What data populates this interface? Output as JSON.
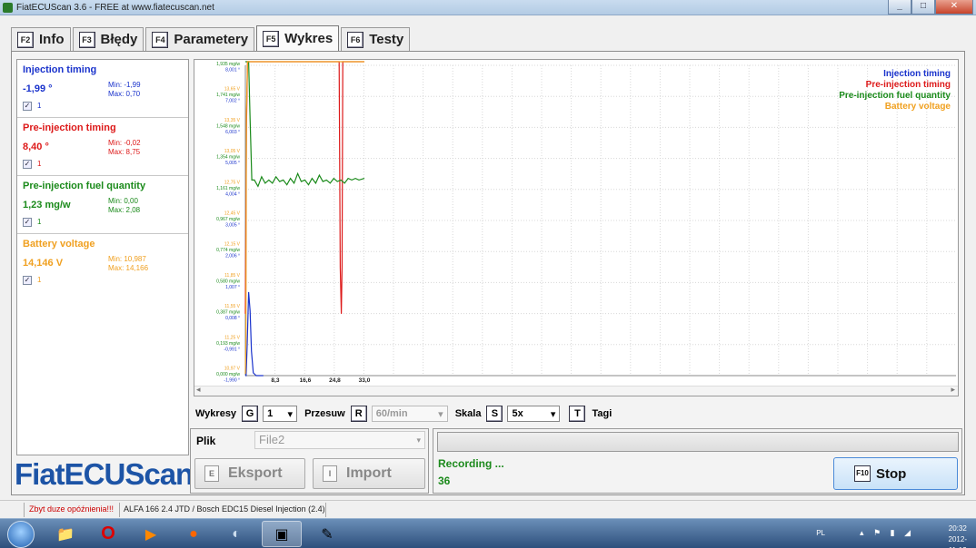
{
  "window": {
    "title": "FiatECUScan 3.6 - FREE at www.fiatecuscan.net"
  },
  "tabs": [
    {
      "key": "F2",
      "label": "Info"
    },
    {
      "key": "F3",
      "label": "Błędy"
    },
    {
      "key": "F4",
      "label": "Parametery"
    },
    {
      "key": "F5",
      "label": "Wykres"
    },
    {
      "key": "F6",
      "label": "Testy"
    }
  ],
  "params": [
    {
      "name": "Injection timing",
      "value": "-1,99 °",
      "min": "Min: -1,99",
      "max": "Max: 0,70",
      "checkbox_label": "1",
      "color": "#1a33cc"
    },
    {
      "name": "Pre-injection timing",
      "value": "8,40 °",
      "min": "Min: -0,02",
      "max": "Max: 8,75",
      "checkbox_label": "1",
      "color": "#dd1a1a"
    },
    {
      "name": "Pre-injection fuel quantity",
      "value": "1,23 mg/w",
      "min": "Min: 0,00",
      "max": "Max: 2,08",
      "checkbox_label": "1",
      "color": "#1a8a1a"
    },
    {
      "name": "Battery voltage",
      "value": "14,146 V",
      "min": "Min: 10,987",
      "max": "Max: 14,166",
      "checkbox_label": "1",
      "color": "#f0a020"
    }
  ],
  "logo": "FiatECUScan",
  "chart_data": {
    "type": "line",
    "x_ticks": [
      "8,3",
      "16,6",
      "24,8",
      "33,0"
    ],
    "xlim": [
      0,
      33
    ],
    "y_tick_labels": [
      [
        "13,34 V",
        "1,935 mg/w",
        "8,001 °"
      ],
      [
        "13,65 V",
        "1,741 mg/w",
        "7,002 °"
      ],
      [
        "13,35 V",
        "1,548 mg/w",
        "6,003 °"
      ],
      [
        "13,05 V",
        "1,354 mg/w",
        "5,005 °"
      ],
      [
        "12,75 V",
        "1,161 mg/w",
        "4,004 °"
      ],
      [
        "12,45 V",
        "0,967 mg/w",
        "3,005 °"
      ],
      [
        "12,15 V",
        "0,774 mg/w",
        "2,006 °"
      ],
      [
        "11,85 V",
        "0,580 mg/w",
        "1,007 °"
      ],
      [
        "11,55 V",
        "0,387 mg/w",
        "0,008 °"
      ],
      [
        "11,25 V",
        "0,193 mg/w",
        "-0,991 °"
      ],
      [
        "10,97 V",
        "0,000 mg/w",
        "-1,990 °"
      ]
    ],
    "legend": [
      "Injection timing",
      "Pre-injection timing",
      "Pre-injection fuel quantity",
      "Battery voltage"
    ],
    "legend_position": "top-right",
    "grid": true,
    "series": [
      {
        "name": "Injection timing",
        "color": "#1a33cc",
        "x": [
          0,
          0.2,
          0.5,
          0.9,
          1.3,
          1.7,
          2.2,
          3,
          4,
          5
        ],
        "y": [
          -1.99,
          -1.99,
          -1.0,
          0.7,
          0.1,
          -1.2,
          -1.9,
          -1.99,
          -1.99,
          -1.99
        ]
      },
      {
        "name": "Pre-injection timing",
        "color": "#dd1a1a",
        "x": [
          0,
          0.3,
          0.6,
          1.0,
          1.5,
          3,
          8,
          14,
          20,
          25.5,
          26,
          26.3,
          26.6,
          26.8,
          27.0,
          27.3,
          27.8,
          33
        ],
        "y": [
          0.0,
          6.0,
          8.6,
          8.75,
          8.5,
          8.4,
          8.4,
          8.4,
          8.4,
          8.4,
          8.4,
          1.5,
          0.0,
          1.5,
          8.4,
          8.3,
          8.4,
          8.4
        ]
      },
      {
        "name": "Pre-injection fuel quantity",
        "color": "#1a8a1a",
        "x": [
          0,
          0.5,
          0.9,
          1.3,
          1.8,
          2.5,
          3.5,
          4.5,
          5.5,
          6.5,
          7.5,
          8.5,
          9.5,
          10.5,
          11.5,
          12.5,
          13.5,
          14.5,
          15.5,
          16.5,
          17.5,
          18.5,
          19.5,
          20.5,
          21.5,
          22.5,
          23.5,
          24.5,
          25.5,
          26.5,
          27.5,
          28.5,
          29.5,
          30.5,
          31.5,
          33
        ],
        "y": [
          2.08,
          2.08,
          2.0,
          1.6,
          1.22,
          1.22,
          1.18,
          1.24,
          1.2,
          1.22,
          1.2,
          1.24,
          1.21,
          1.22,
          1.19,
          1.23,
          1.2,
          1.26,
          1.21,
          1.22,
          1.19,
          1.23,
          1.2,
          1.25,
          1.21,
          1.22,
          1.2,
          1.23,
          1.21,
          1.22,
          1.2,
          1.23,
          1.22,
          1.23,
          1.22,
          1.23
        ]
      },
      {
        "name": "Battery voltage",
        "color": "#f0a020",
        "x": [
          0,
          0.15,
          0.3,
          0.6,
          1.0,
          2,
          4,
          6,
          8,
          10,
          12,
          14,
          16,
          18,
          20,
          22,
          24,
          26,
          28,
          30,
          32,
          33
        ],
        "y": [
          10.987,
          11.3,
          13.5,
          14.166,
          14.1,
          14.12,
          14.15,
          14.13,
          14.14,
          14.15,
          14.13,
          14.15,
          14.14,
          14.15,
          14.16,
          14.14,
          14.15,
          14.16,
          14.15,
          14.16,
          14.14,
          14.146
        ]
      }
    ]
  },
  "controls": {
    "wykresy_label": "Wykresy",
    "wykresy_key": "G",
    "wykresy_value": "1",
    "przesuw_label": "Przesuw",
    "przesuw_key": "R",
    "przesuw_value": "60/min",
    "skala_label": "Skala",
    "skala_key": "S",
    "skala_value": "5x",
    "tagi_key": "T",
    "tagi_label": "Tagi"
  },
  "file": {
    "label": "Plik",
    "value": "File2"
  },
  "buttons": {
    "export_key": "E",
    "export_label": "Eksport",
    "import_key": "I",
    "import_label": "Import",
    "stop_key": "F10",
    "stop_label": "Stop"
  },
  "recording": {
    "status": "Recording ...",
    "count": "36"
  },
  "statusbar": {
    "warning": "Zbyt duze opóźnienia!!!",
    "vehicle": "ALFA 166 2.4 JTD / Bosch EDC15 Diesel Injection (2.4)"
  },
  "taskbar": {
    "lang": "PL",
    "time": "20:32",
    "date": "2012-11-13"
  }
}
